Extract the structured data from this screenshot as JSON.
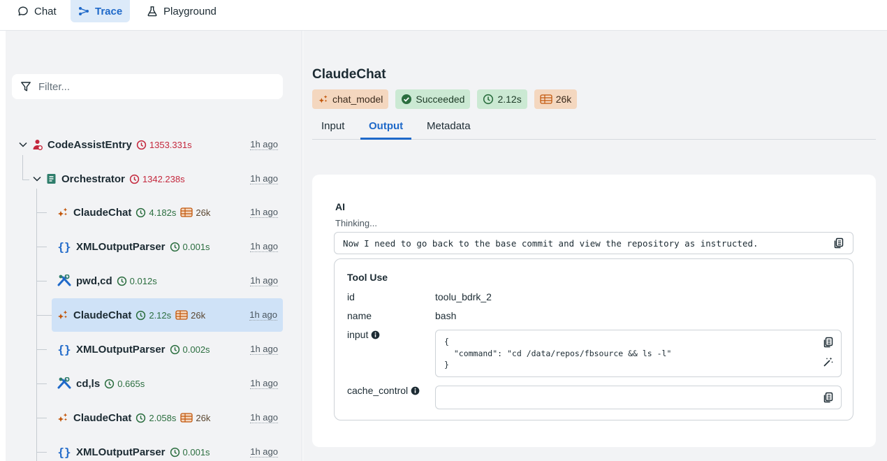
{
  "nav": {
    "tabs": [
      {
        "label": "Chat",
        "icon": "chat-bubble-icon"
      },
      {
        "label": "Trace",
        "icon": "trace-icon"
      },
      {
        "label": "Playground",
        "icon": "flask-icon"
      }
    ],
    "active": "Trace"
  },
  "filter": {
    "placeholder": "Filter..."
  },
  "tree": [
    {
      "name": "CodeAssistEntry",
      "meta": "1353.331s",
      "ago": "1h ago",
      "icon": "agent-icon"
    },
    {
      "name": "Orchestrator",
      "meta": "1342.238s",
      "ago": "1h ago",
      "icon": "notebook-icon"
    },
    {
      "name": "ClaudeChat",
      "meta": "4.182s",
      "tokens": "26k",
      "ago": "1h ago",
      "icon": "sparkle-icon"
    },
    {
      "name": "XMLOutputParser",
      "meta": "0.001s",
      "ago": "1h ago",
      "icon": "braces-icon"
    },
    {
      "name": "pwd,cd",
      "meta": "0.012s",
      "ago": "1h ago",
      "icon": "tools-icon"
    },
    {
      "name": "ClaudeChat",
      "meta": "2.12s",
      "tokens": "26k",
      "ago": "1h ago",
      "icon": "sparkle-icon",
      "selected": true
    },
    {
      "name": "XMLOutputParser",
      "meta": "0.002s",
      "ago": "1h ago",
      "icon": "braces-icon"
    },
    {
      "name": "cd,ls",
      "meta": "0.665s",
      "ago": "1h ago",
      "icon": "tools-icon"
    },
    {
      "name": "ClaudeChat",
      "meta": "2.058s",
      "tokens": "26k",
      "ago": "1h ago",
      "icon": "sparkle-icon"
    },
    {
      "name": "XMLOutputParser",
      "meta": "0.001s",
      "ago": "1h ago",
      "icon": "braces-icon"
    }
  ],
  "detail": {
    "title": "ClaudeChat",
    "badges": {
      "type": "chat_model",
      "status": "Succeeded",
      "duration": "2.12s",
      "tokens": "26k"
    },
    "tabs": [
      "Input",
      "Output",
      "Metadata"
    ],
    "active_tab": "Output",
    "ai_label": "AI",
    "thinking": "Thinking...",
    "message": "Now I need to go back to the base commit and view the repository as instructed.",
    "tool_use": {
      "title": "Tool Use",
      "id_key": "id",
      "id_value": "toolu_bdrk_2",
      "name_key": "name",
      "name_value": "bash",
      "input_key": "input",
      "input_code": "{\n  \"command\": \"cd /data/repos/fbsource && ls -l\"\n}",
      "cache_key": "cache_control",
      "cache_value": ""
    }
  },
  "colors": {
    "accent": "#1f69c9",
    "green": "#2b6e3f",
    "red": "#c4283d",
    "orange": "#c2570c",
    "teal": "#2e7d6b"
  }
}
